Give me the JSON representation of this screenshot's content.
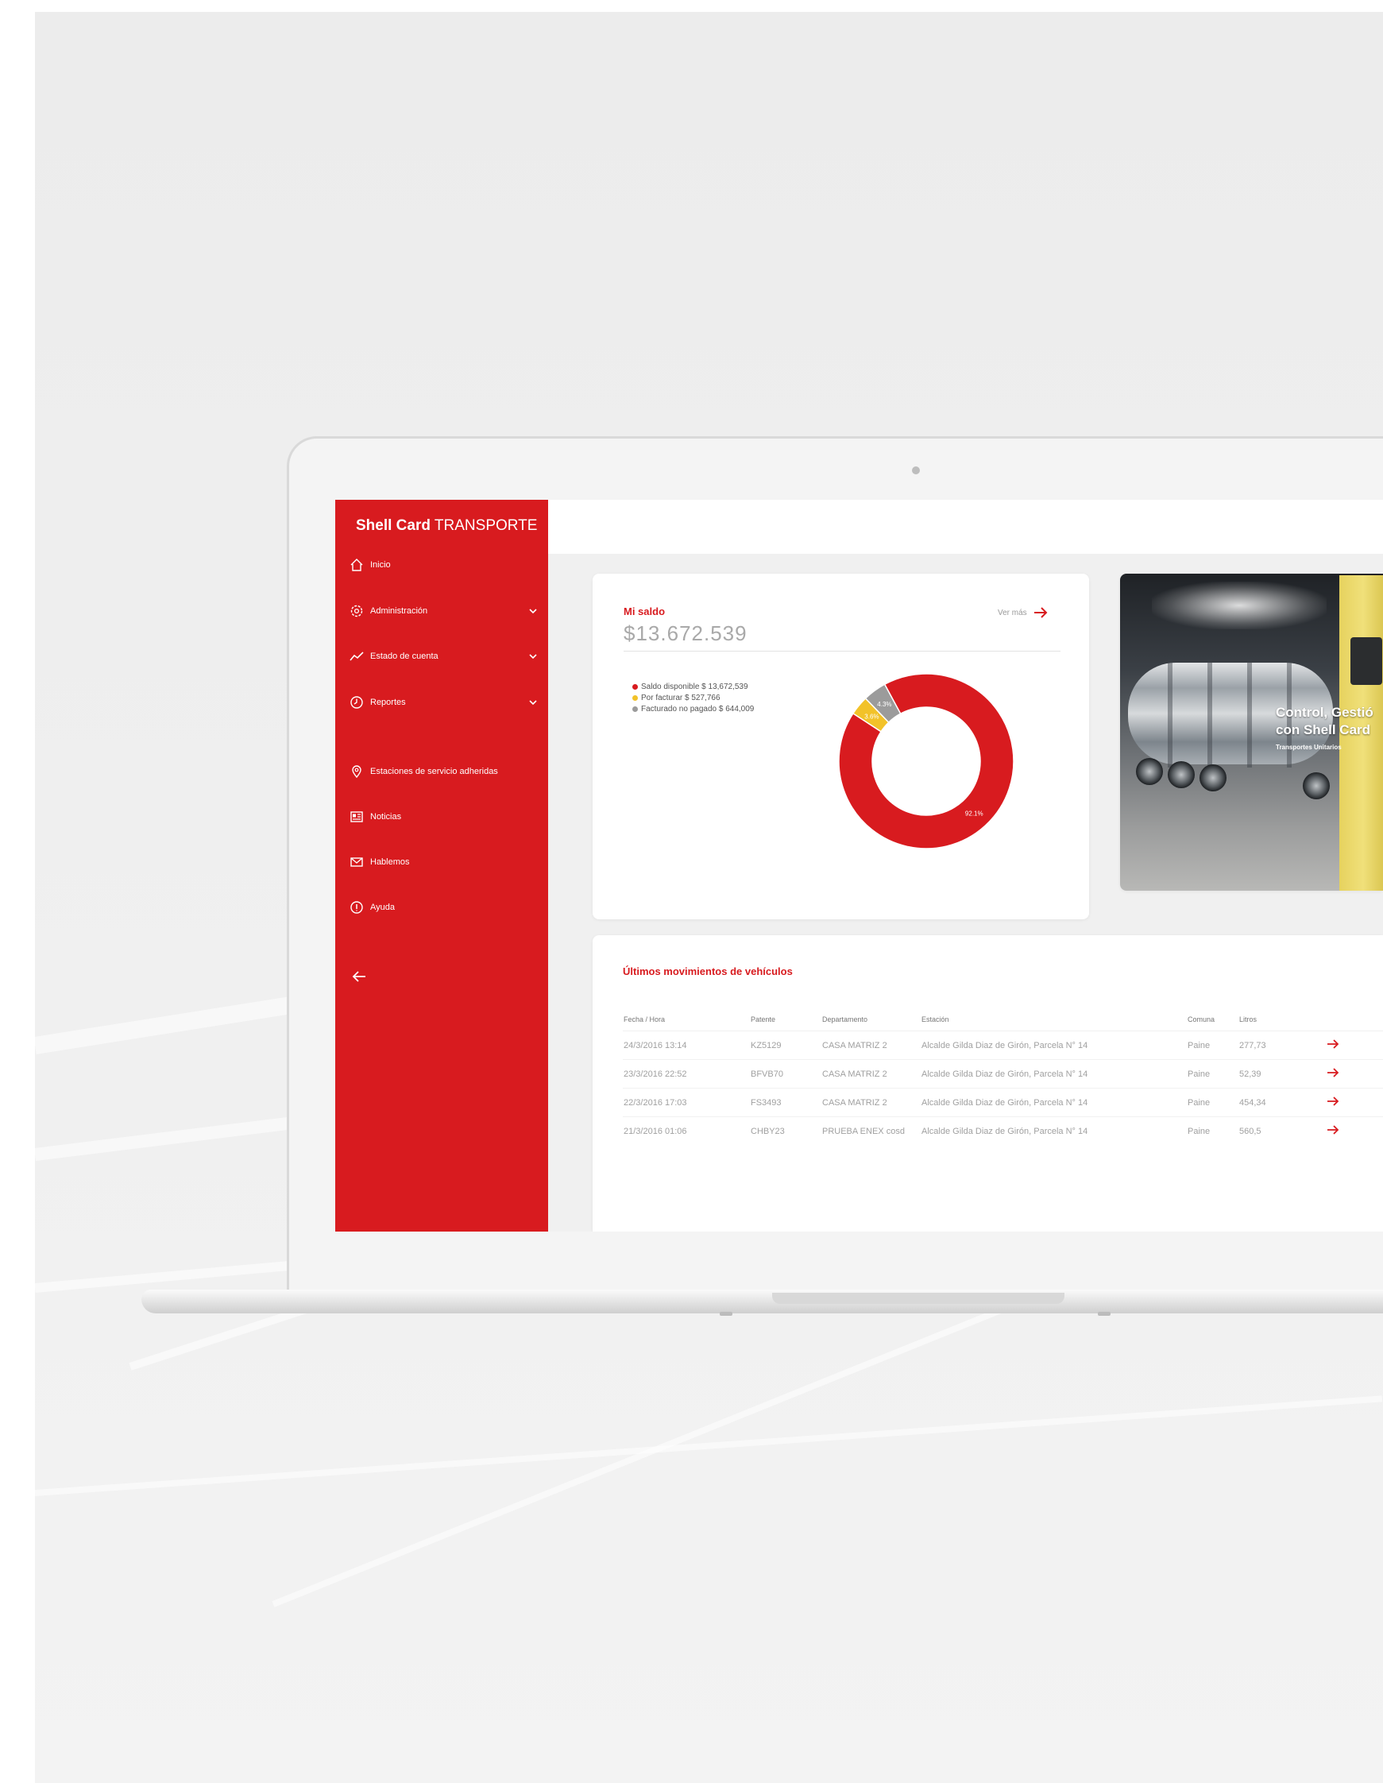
{
  "app": {
    "brand_strong": "Shell Card",
    "brand_light": " TRANSPORTE"
  },
  "colors": {
    "brand_red": "#d81b1f",
    "yellow": "#f2c229",
    "gray": "#9b9b9b",
    "muted_text": "#a9a9a9"
  },
  "sidebar": {
    "items": [
      {
        "label": "Inicio",
        "icon": "home-icon",
        "has_chevron": false
      },
      {
        "label": "Administración",
        "icon": "gear-icon",
        "has_chevron": true
      },
      {
        "label": "Estado de cuenta",
        "icon": "trend-line-icon",
        "has_chevron": true
      },
      {
        "label": "Reportes",
        "icon": "clock-icon",
        "has_chevron": true
      },
      {
        "label": "Estaciones de servicio adheridas",
        "icon": "map-pin-icon",
        "has_chevron": false
      },
      {
        "label": "Noticias",
        "icon": "newspaper-icon",
        "has_chevron": false
      },
      {
        "label": "Hablemos",
        "icon": "mail-icon",
        "has_chevron": false
      },
      {
        "label": "Ayuda",
        "icon": "info-icon",
        "has_chevron": false
      }
    ],
    "back_icon": "arrow-left-icon"
  },
  "balance": {
    "title": "Mi saldo",
    "amount": "$13.672.539",
    "ver_mas": "Ver más",
    "legend": [
      "Saldo disponible $ 13,672,539",
      "Por facturar $ 527,766",
      "Facturado no pagado $ 644,009"
    ]
  },
  "chart_data": {
    "type": "pie",
    "categories": [
      "Saldo disponible",
      "Por facturar",
      "Facturado no pagado"
    ],
    "values": [
      13672539,
      527766,
      644009
    ],
    "colors": [
      "#d81b1f",
      "#f2c229",
      "#9b9b9b"
    ],
    "data_labels": [
      "92.1%",
      "3.6%",
      "4.3%"
    ],
    "title": ""
  },
  "promo": {
    "line1": "Control, Gestió",
    "line2": "con Shell Card",
    "sub": "Transportes Unitarios"
  },
  "movements": {
    "title": "Últimos movimientos de vehículos",
    "columns": [
      "Fecha / Hora",
      "Patente",
      "Departamento",
      "Estación",
      "Comuna",
      "Litros"
    ],
    "rows": [
      [
        "24/3/2016 13:14",
        "KZ5129",
        "CASA MATRIZ 2",
        "Alcalde Gilda Diaz de Girón, Parcela N° 14",
        "Paine",
        "277,73"
      ],
      [
        "23/3/2016 22:52",
        "BFVB70",
        "CASA MATRIZ 2",
        "Alcalde Gilda Diaz de Girón, Parcela N° 14",
        "Paine",
        "52,39"
      ],
      [
        "22/3/2016 17:03",
        "FS3493",
        "CASA MATRIZ 2",
        "Alcalde Gilda Diaz de Girón, Parcela N° 14",
        "Paine",
        "454,34"
      ],
      [
        "21/3/2016 01:06",
        "CHBY23",
        "PRUEBA ENEX cosd",
        "Alcalde Gilda Diaz de Girón, Parcela N° 14",
        "Paine",
        "560,5"
      ]
    ]
  }
}
